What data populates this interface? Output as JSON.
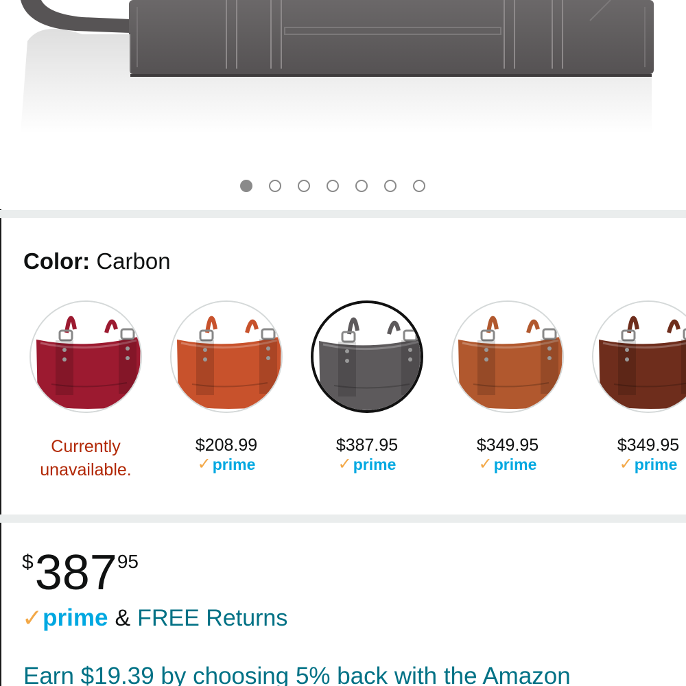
{
  "gallery": {
    "image_count": 7,
    "active_index": 0
  },
  "color": {
    "label": "Color:",
    "selected": "Carbon"
  },
  "swatches": [
    {
      "name": "red",
      "price": "",
      "status": "Currently unavailable.",
      "prime": false,
      "selected": false,
      "color": "#9c1a30"
    },
    {
      "name": "orange",
      "price": "$208.99",
      "status": "",
      "prime": true,
      "selected": false,
      "color": "#c8522c"
    },
    {
      "name": "carbon",
      "price": "$387.95",
      "status": "",
      "prime": true,
      "selected": true,
      "color": "#5d5a5c"
    },
    {
      "name": "cognac",
      "price": "$349.95",
      "status": "",
      "prime": true,
      "selected": false,
      "color": "#b1582e"
    },
    {
      "name": "dark-brown",
      "price": "$349.95",
      "status": "",
      "prime": true,
      "selected": false,
      "color": "#6e2d1c"
    }
  ],
  "prime_label": "prime",
  "price": {
    "currency": "$",
    "whole": "387",
    "fraction": "95"
  },
  "shipping": {
    "amp": "&",
    "returns": "FREE Returns"
  },
  "promo": {
    "text": "Earn $19.39 by choosing 5% back with the Amazon"
  },
  "colors": {
    "prime_blue": "#00a8e1",
    "prime_check": "#f3a847",
    "link_teal": "#007185",
    "unavailable_red": "#b12704"
  }
}
